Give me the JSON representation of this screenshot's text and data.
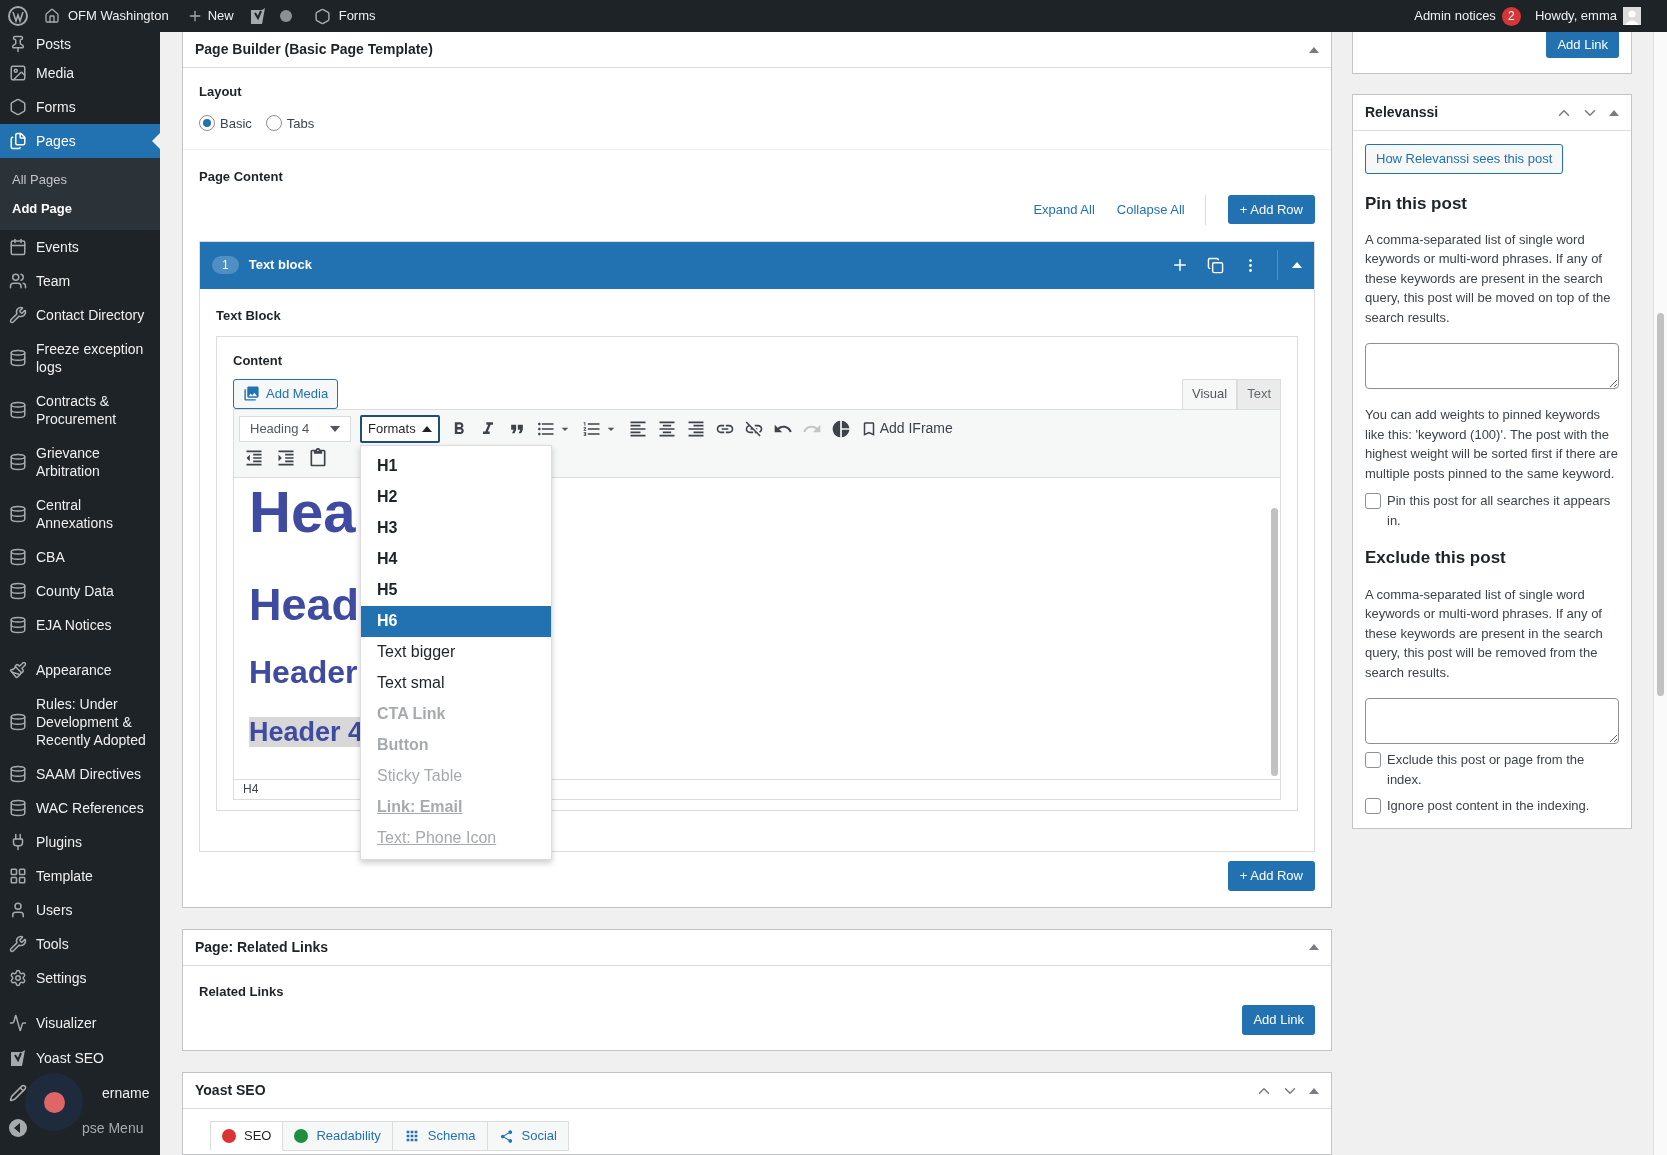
{
  "admin_bar": {
    "site": "OFM Washington",
    "new": "New",
    "forms": "Forms",
    "notices": "Admin notices",
    "notices_count": "2",
    "greeting": "Howdy, emma"
  },
  "sidebar": {
    "items": [
      {
        "label": "Posts",
        "selected": false
      },
      {
        "label": "Media",
        "selected": false
      },
      {
        "label": "Forms",
        "selected": false
      },
      {
        "label": "Pages",
        "selected": true,
        "children": [
          {
            "label": "All Pages",
            "selected": false
          },
          {
            "label": "Add Page",
            "selected": true
          }
        ]
      },
      {
        "label": "Events",
        "selected": false
      },
      {
        "label": "Team",
        "selected": false
      },
      {
        "label": "Contact Directory",
        "selected": false
      },
      {
        "label": "Freeze exception logs",
        "selected": false
      },
      {
        "label": "Contracts & Procurement",
        "selected": false
      },
      {
        "label": "Grievance Arbitration",
        "selected": false
      },
      {
        "label": "Central Annexations",
        "selected": false
      },
      {
        "label": "CBA",
        "selected": false
      },
      {
        "label": "County Data",
        "selected": false
      },
      {
        "label": "EJA Notices",
        "selected": false
      },
      {
        "label": "Appearance",
        "selected": false
      },
      {
        "label": "Rules: Under Development & Recently Adopted",
        "selected": false
      },
      {
        "label": "SAAM Directives",
        "selected": false
      },
      {
        "label": "WAC References",
        "selected": false
      },
      {
        "label": "Plugins",
        "selected": false
      },
      {
        "label": "Template",
        "selected": false
      },
      {
        "label": "Users",
        "selected": false
      },
      {
        "label": "Tools",
        "selected": false
      },
      {
        "label": "Settings",
        "selected": false
      },
      {
        "label": "Visualizer",
        "selected": false
      },
      {
        "label": "Yoast SEO",
        "selected": false
      },
      {
        "label": "ername",
        "selected": false
      },
      {
        "label": "pse Menu",
        "selected": false
      }
    ]
  },
  "page_builder": {
    "title": "Page Builder (Basic Page Template)",
    "layout": {
      "label": "Layout",
      "options": [
        {
          "label": "Basic",
          "selected": true
        },
        {
          "label": "Tabs",
          "selected": false
        }
      ]
    },
    "page_content": {
      "label": "Page Content",
      "expand_all": "Expand All",
      "collapse_all": "Collapse All",
      "add_row": "+ Add Row"
    },
    "block": {
      "number": "1",
      "title": "Text block",
      "label": "Text Block",
      "content_label": "Content",
      "add_media": "Add Media",
      "tabs": [
        {
          "label": "Visual",
          "selected": true
        },
        {
          "label": "Text",
          "selected": false
        }
      ],
      "block_format": "Heading 4",
      "formats": "Formats",
      "add_iframe": "Add IFrame",
      "formats_menu": [
        {
          "label": "H1",
          "kind": "bold",
          "selected": false,
          "disabled": false,
          "underlined": false
        },
        {
          "label": "H2",
          "kind": "bold",
          "selected": false,
          "disabled": false,
          "underlined": false
        },
        {
          "label": "H3",
          "kind": "bold",
          "selected": false,
          "disabled": false,
          "underlined": false
        },
        {
          "label": "H4",
          "kind": "bold",
          "selected": false,
          "disabled": false,
          "underlined": false
        },
        {
          "label": "H5",
          "kind": "bold",
          "selected": false,
          "disabled": false,
          "underlined": false
        },
        {
          "label": "H6",
          "kind": "bold",
          "selected": true,
          "disabled": false,
          "underlined": false
        },
        {
          "label": "Text bigger",
          "kind": "plain",
          "selected": false,
          "disabled": false,
          "underlined": false
        },
        {
          "label": "Text smal",
          "kind": "plain",
          "selected": false,
          "disabled": false,
          "underlined": false
        },
        {
          "label": "CTA Link",
          "kind": "bold",
          "selected": false,
          "disabled": true,
          "underlined": false
        },
        {
          "label": "Button",
          "kind": "bold",
          "selected": false,
          "disabled": true,
          "underlined": false
        },
        {
          "label": "Sticky Table",
          "kind": "plain",
          "selected": false,
          "disabled": true,
          "underlined": false
        },
        {
          "label": "Link: Email",
          "kind": "bold",
          "selected": false,
          "disabled": true,
          "underlined": true
        },
        {
          "label": "Text: Phone Icon",
          "kind": "plain",
          "selected": false,
          "disabled": true,
          "underlined": true
        }
      ],
      "editor_lines": [
        {
          "text": "Hea",
          "kind": "h1",
          "highlighted": false
        },
        {
          "text": "Head",
          "kind": "h2",
          "highlighted": false
        },
        {
          "text": "Header",
          "kind": "h3",
          "highlighted": false
        },
        {
          "text": "Header 4",
          "kind": "h4",
          "highlighted": true
        }
      ],
      "status_path": "H4"
    },
    "add_row_bottom": "+ Add Row"
  },
  "related_links": {
    "title": "Page: Related Links",
    "label": "Related Links",
    "button": "Add Link"
  },
  "yoast": {
    "title": "Yoast SEO",
    "tabs": [
      {
        "label": "SEO",
        "kind": "score",
        "color": "#dc3232",
        "selected": true
      },
      {
        "label": "Readability",
        "kind": "score",
        "color": "#1e8e3e",
        "selected": false
      },
      {
        "label": "Schema",
        "kind": "schema",
        "selected": false
      },
      {
        "label": "Social",
        "kind": "social",
        "selected": false
      }
    ]
  },
  "side_top": {
    "button": "Add Link"
  },
  "relevanssi": {
    "title": "Relevanssi",
    "button": "How Relevanssi sees this post",
    "pin": {
      "heading": "Pin this post",
      "description": "A comma-separated list of single word keywords or multi-word phrases. If any of these keywords are present in the search query, this post will be moved on top of the search results.",
      "note": "You can add weights to pinned keywords like this: 'keyword (100)'. The post with the highest weight will be sorted first if there are multiple posts pinned to the same keyword.",
      "checkboxes": [
        {
          "label": "Pin this post for all searches it appears in.",
          "checked": false
        }
      ]
    },
    "exclude": {
      "heading": "Exclude this post",
      "description": "A comma-separated list of single word keywords or multi-word phrases. If any of these keywords are present in the search query, this post will be removed from the search results.",
      "checkboxes": [
        {
          "label": "Exclude this post or page from the index.",
          "checked": false
        },
        {
          "label": "Ignore post content in the indexing.",
          "checked": false
        }
      ]
    }
  }
}
